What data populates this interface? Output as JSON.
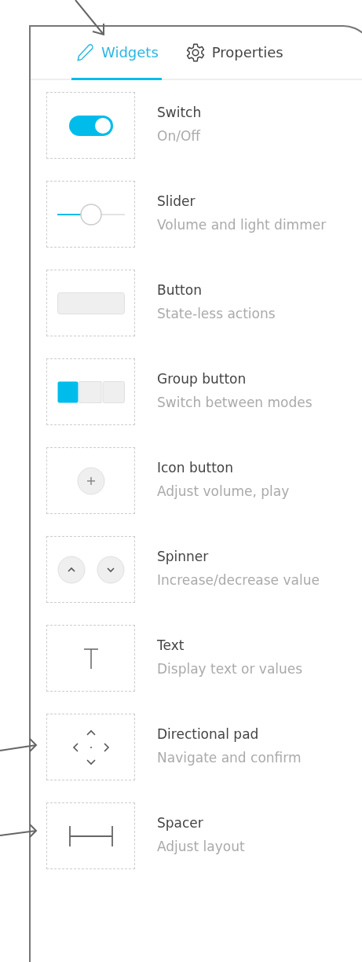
{
  "tabs": [
    {
      "label": "Widgets",
      "kind": "pencil",
      "selected": true
    },
    {
      "label": "Properties",
      "kind": "gear",
      "selected": false
    }
  ],
  "widgets": [
    {
      "kind": "switch",
      "title": "Switch",
      "description": "On/Off"
    },
    {
      "kind": "slider",
      "title": "Slider",
      "description": "Volume and light dimmer"
    },
    {
      "kind": "button",
      "title": "Button",
      "description": "State-less actions"
    },
    {
      "kind": "group",
      "title": "Group button",
      "description": "Switch between modes"
    },
    {
      "kind": "icon",
      "title": "Icon button",
      "description": "Adjust volume, play"
    },
    {
      "kind": "spinner",
      "title": "Spinner",
      "description": "Increase/decrease value"
    },
    {
      "kind": "text",
      "title": "Text",
      "description": "Display text or values"
    },
    {
      "kind": "dpad",
      "title": "Directional pad",
      "description": "Navigate and confirm"
    },
    {
      "kind": "spacer",
      "title": "Spacer",
      "description": "Adjust layout"
    }
  ]
}
